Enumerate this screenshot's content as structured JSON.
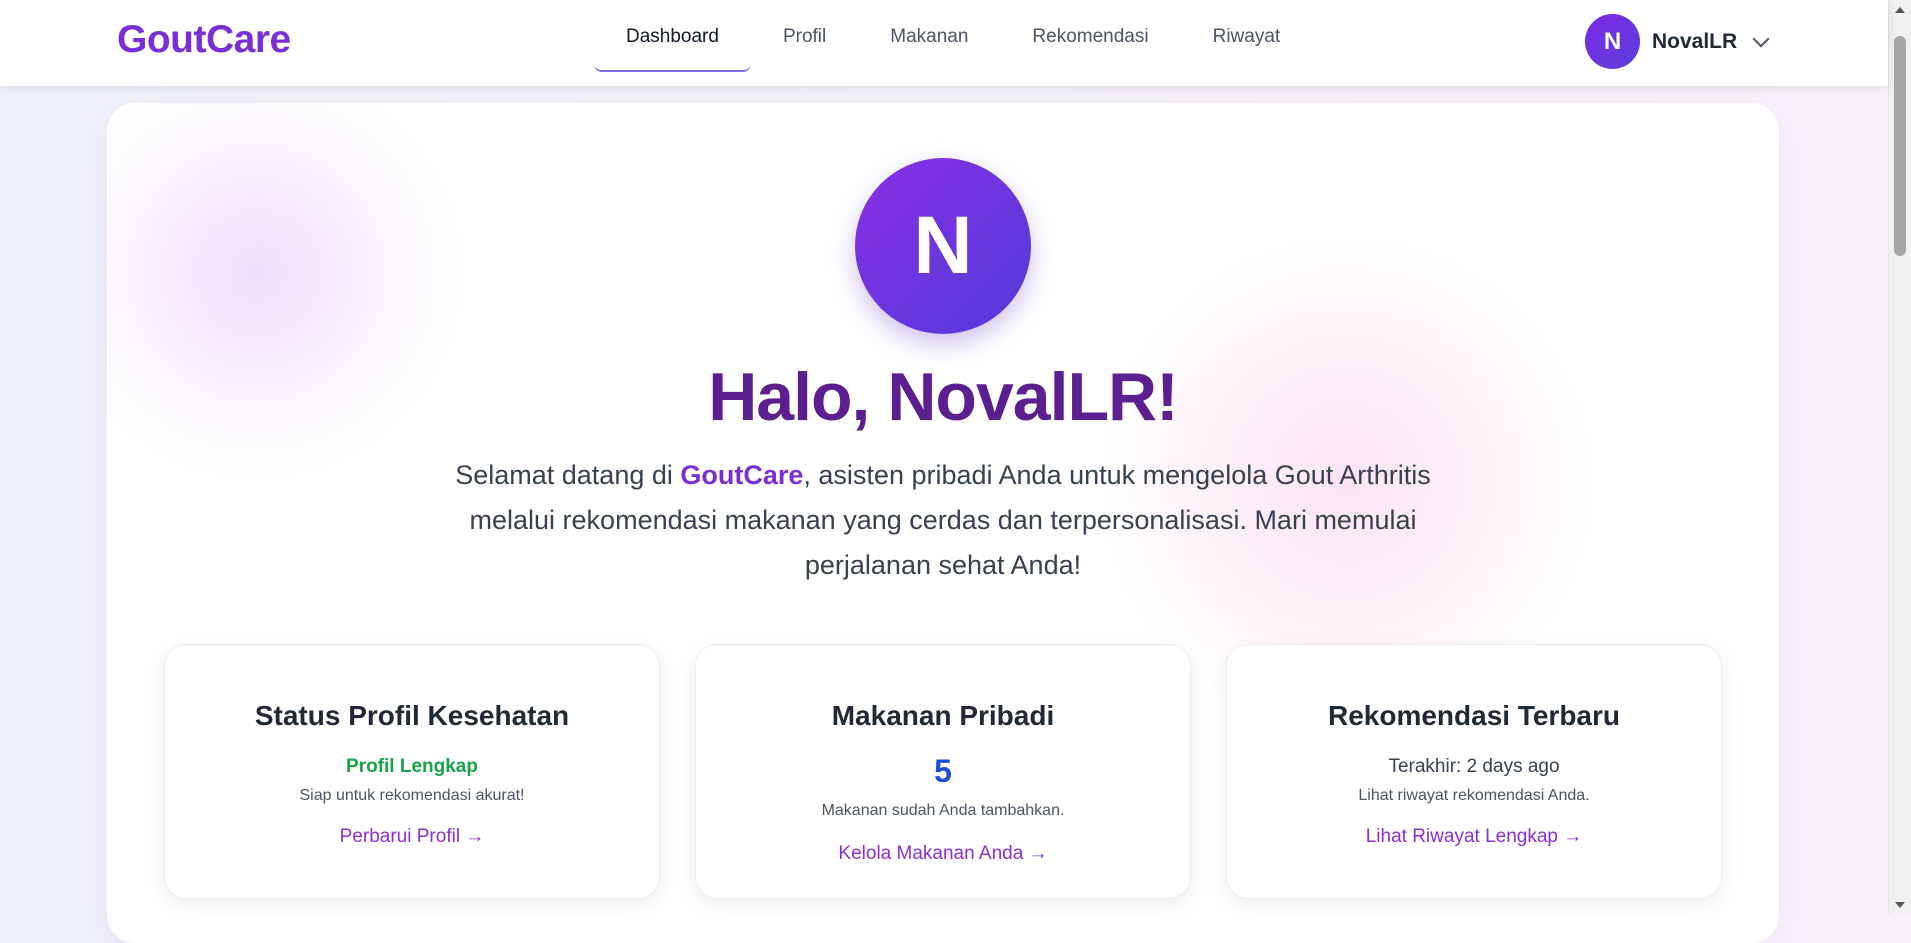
{
  "nav": {
    "brand": "GoutCare",
    "links": [
      {
        "label": "Dashboard",
        "active": true
      },
      {
        "label": "Profil",
        "active": false
      },
      {
        "label": "Makanan",
        "active": false
      },
      {
        "label": "Rekomendasi",
        "active": false
      },
      {
        "label": "Riwayat",
        "active": false
      }
    ],
    "user": {
      "initial": "N",
      "name": "NovalLR"
    }
  },
  "hero": {
    "avatar_initial": "N",
    "title": "Halo, NovalLR!",
    "text_before": "Selamat datang di ",
    "text_brand": "GoutCare",
    "text_after": ", asisten pribadi Anda untuk mengelola Gout Arthritis melalui rekomendasi makanan yang cerdas dan terpersonalisasi. Mari memulai perjalanan sehat Anda!"
  },
  "cards": {
    "profile": {
      "title": "Status Profil Kesehatan",
      "status": "Profil Lengkap",
      "subtitle": "Siap untuk rekomendasi akurat!",
      "link": "Perbarui Profil →"
    },
    "food": {
      "title": "Makanan Pribadi",
      "count": "5",
      "subtitle": "Makanan sudah Anda tambahkan.",
      "link": "Kelola Makanan Anda →"
    },
    "recommendation": {
      "title": "Rekomendasi Terbaru",
      "last": "Terakhir: 2 days ago",
      "subtitle": "Lihat riwayat rekomendasi Anda.",
      "link": "Lihat Riwayat Lengkap →"
    }
  },
  "colors": {
    "brand": "#7a2fd6",
    "title": "#5b1f8f",
    "success": "#16a34a",
    "count": "#1d4ed8",
    "link": "#8b2fd6"
  }
}
